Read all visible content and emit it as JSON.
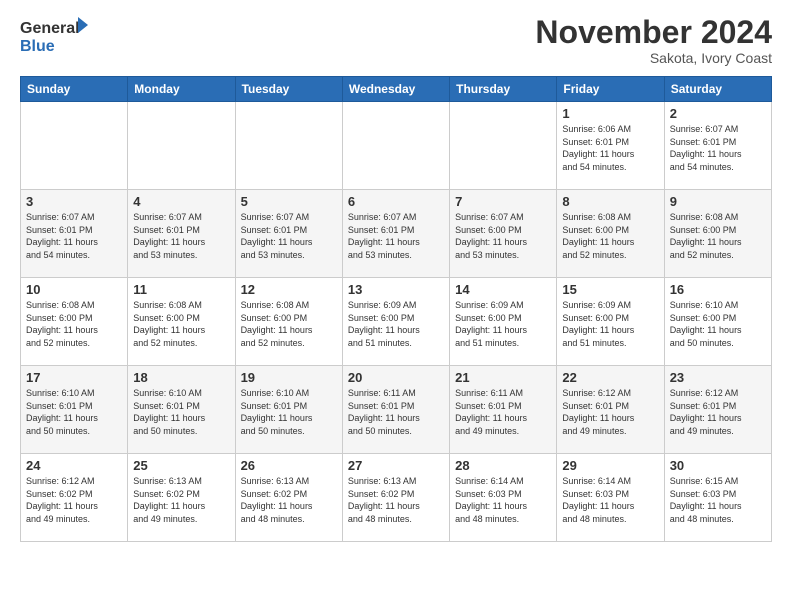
{
  "header": {
    "logo_general": "General",
    "logo_blue": "Blue",
    "month_title": "November 2024",
    "location": "Sakota, Ivory Coast"
  },
  "weekdays": [
    "Sunday",
    "Monday",
    "Tuesday",
    "Wednesday",
    "Thursday",
    "Friday",
    "Saturday"
  ],
  "weeks": [
    [
      {
        "day": "",
        "info": ""
      },
      {
        "day": "",
        "info": ""
      },
      {
        "day": "",
        "info": ""
      },
      {
        "day": "",
        "info": ""
      },
      {
        "day": "",
        "info": ""
      },
      {
        "day": "1",
        "info": "Sunrise: 6:06 AM\nSunset: 6:01 PM\nDaylight: 11 hours\nand 54 minutes."
      },
      {
        "day": "2",
        "info": "Sunrise: 6:07 AM\nSunset: 6:01 PM\nDaylight: 11 hours\nand 54 minutes."
      }
    ],
    [
      {
        "day": "3",
        "info": "Sunrise: 6:07 AM\nSunset: 6:01 PM\nDaylight: 11 hours\nand 54 minutes."
      },
      {
        "day": "4",
        "info": "Sunrise: 6:07 AM\nSunset: 6:01 PM\nDaylight: 11 hours\nand 53 minutes."
      },
      {
        "day": "5",
        "info": "Sunrise: 6:07 AM\nSunset: 6:01 PM\nDaylight: 11 hours\nand 53 minutes."
      },
      {
        "day": "6",
        "info": "Sunrise: 6:07 AM\nSunset: 6:01 PM\nDaylight: 11 hours\nand 53 minutes."
      },
      {
        "day": "7",
        "info": "Sunrise: 6:07 AM\nSunset: 6:00 PM\nDaylight: 11 hours\nand 53 minutes."
      },
      {
        "day": "8",
        "info": "Sunrise: 6:08 AM\nSunset: 6:00 PM\nDaylight: 11 hours\nand 52 minutes."
      },
      {
        "day": "9",
        "info": "Sunrise: 6:08 AM\nSunset: 6:00 PM\nDaylight: 11 hours\nand 52 minutes."
      }
    ],
    [
      {
        "day": "10",
        "info": "Sunrise: 6:08 AM\nSunset: 6:00 PM\nDaylight: 11 hours\nand 52 minutes."
      },
      {
        "day": "11",
        "info": "Sunrise: 6:08 AM\nSunset: 6:00 PM\nDaylight: 11 hours\nand 52 minutes."
      },
      {
        "day": "12",
        "info": "Sunrise: 6:08 AM\nSunset: 6:00 PM\nDaylight: 11 hours\nand 52 minutes."
      },
      {
        "day": "13",
        "info": "Sunrise: 6:09 AM\nSunset: 6:00 PM\nDaylight: 11 hours\nand 51 minutes."
      },
      {
        "day": "14",
        "info": "Sunrise: 6:09 AM\nSunset: 6:00 PM\nDaylight: 11 hours\nand 51 minutes."
      },
      {
        "day": "15",
        "info": "Sunrise: 6:09 AM\nSunset: 6:00 PM\nDaylight: 11 hours\nand 51 minutes."
      },
      {
        "day": "16",
        "info": "Sunrise: 6:10 AM\nSunset: 6:00 PM\nDaylight: 11 hours\nand 50 minutes."
      }
    ],
    [
      {
        "day": "17",
        "info": "Sunrise: 6:10 AM\nSunset: 6:01 PM\nDaylight: 11 hours\nand 50 minutes."
      },
      {
        "day": "18",
        "info": "Sunrise: 6:10 AM\nSunset: 6:01 PM\nDaylight: 11 hours\nand 50 minutes."
      },
      {
        "day": "19",
        "info": "Sunrise: 6:10 AM\nSunset: 6:01 PM\nDaylight: 11 hours\nand 50 minutes."
      },
      {
        "day": "20",
        "info": "Sunrise: 6:11 AM\nSunset: 6:01 PM\nDaylight: 11 hours\nand 50 minutes."
      },
      {
        "day": "21",
        "info": "Sunrise: 6:11 AM\nSunset: 6:01 PM\nDaylight: 11 hours\nand 49 minutes."
      },
      {
        "day": "22",
        "info": "Sunrise: 6:12 AM\nSunset: 6:01 PM\nDaylight: 11 hours\nand 49 minutes."
      },
      {
        "day": "23",
        "info": "Sunrise: 6:12 AM\nSunset: 6:01 PM\nDaylight: 11 hours\nand 49 minutes."
      }
    ],
    [
      {
        "day": "24",
        "info": "Sunrise: 6:12 AM\nSunset: 6:02 PM\nDaylight: 11 hours\nand 49 minutes."
      },
      {
        "day": "25",
        "info": "Sunrise: 6:13 AM\nSunset: 6:02 PM\nDaylight: 11 hours\nand 49 minutes."
      },
      {
        "day": "26",
        "info": "Sunrise: 6:13 AM\nSunset: 6:02 PM\nDaylight: 11 hours\nand 48 minutes."
      },
      {
        "day": "27",
        "info": "Sunrise: 6:13 AM\nSunset: 6:02 PM\nDaylight: 11 hours\nand 48 minutes."
      },
      {
        "day": "28",
        "info": "Sunrise: 6:14 AM\nSunset: 6:03 PM\nDaylight: 11 hours\nand 48 minutes."
      },
      {
        "day": "29",
        "info": "Sunrise: 6:14 AM\nSunset: 6:03 PM\nDaylight: 11 hours\nand 48 minutes."
      },
      {
        "day": "30",
        "info": "Sunrise: 6:15 AM\nSunset: 6:03 PM\nDaylight: 11 hours\nand 48 minutes."
      }
    ]
  ]
}
